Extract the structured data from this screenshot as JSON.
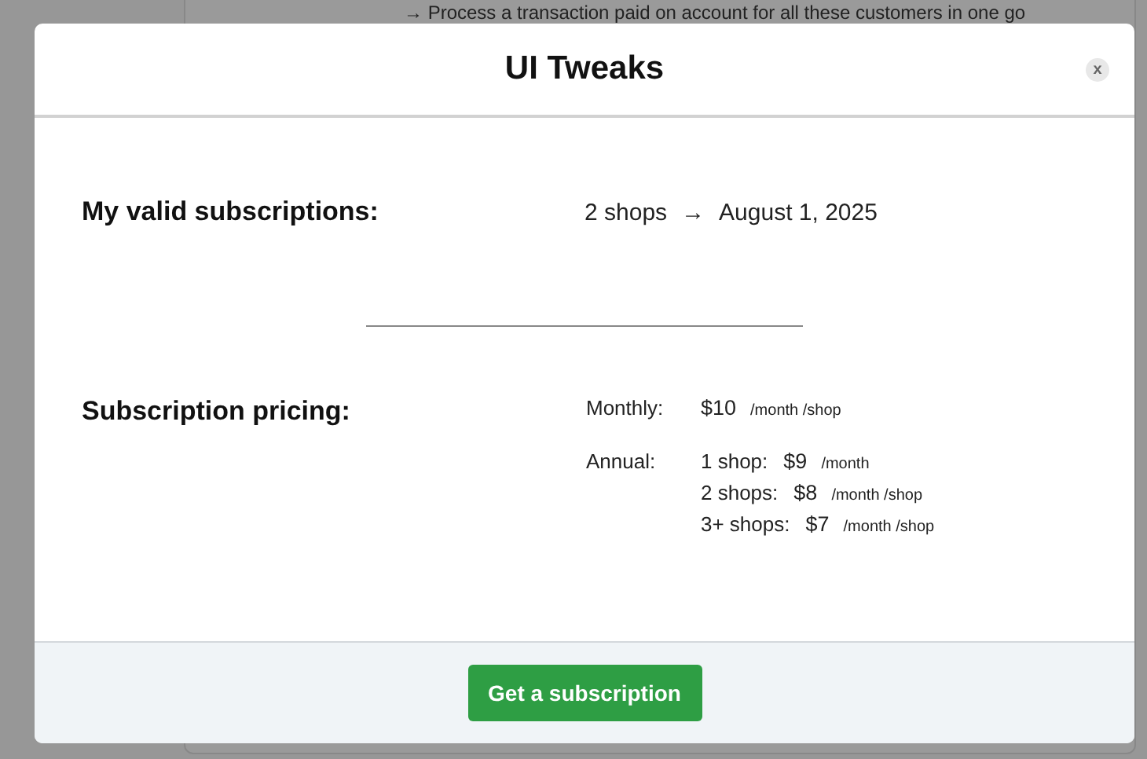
{
  "background": {
    "text": "→ Process a transaction paid on account for all these customers in one go"
  },
  "dialog": {
    "title": "UI Tweaks",
    "close": "x",
    "subscriptions": {
      "label": "My valid subscriptions:",
      "shops": "2 shops",
      "arrow": "→",
      "date": "August 1, 2025"
    },
    "pricing": {
      "label": "Subscription pricing:",
      "monthly": {
        "label": "Monthly:",
        "price": "$10",
        "unit": "/month /shop"
      },
      "annual": {
        "label": "Annual:",
        "tiers": [
          {
            "name": "1 shop:",
            "price": "$9",
            "unit": "/month"
          },
          {
            "name": "2 shops:",
            "price": "$8",
            "unit": "/month /shop"
          },
          {
            "name": "3+ shops:",
            "price": "$7",
            "unit": "/month /shop"
          }
        ]
      }
    },
    "button": "Get a subscription"
  }
}
